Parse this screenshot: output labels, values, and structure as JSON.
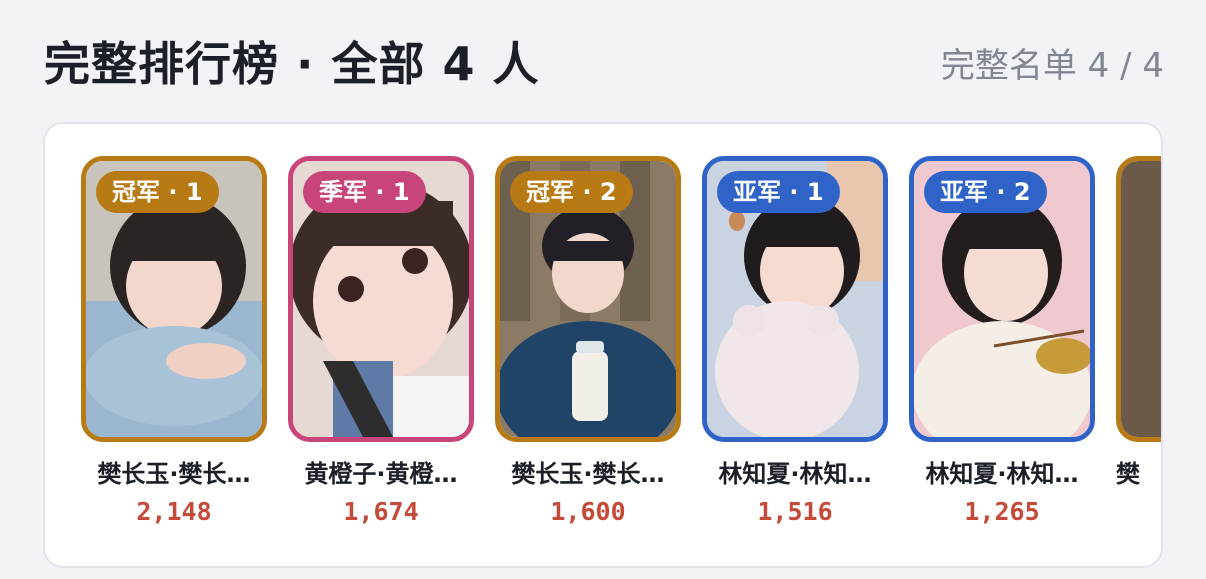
{
  "header": {
    "title": "完整排行榜 · 全部 4 人",
    "count": "完整名单 4 / 4"
  },
  "colors": {
    "champion": "#b87a14",
    "season": "#c8457a",
    "runner_up": "#2f63c8"
  },
  "cards": [
    {
      "badge": "冠军 · 1",
      "tier": "champion",
      "name": "樊长玉·樊长…",
      "votes": "2,148"
    },
    {
      "badge": "季军 · 1",
      "tier": "season",
      "name": "黄橙子·黄橙…",
      "votes": "1,674"
    },
    {
      "badge": "冠军 · 2",
      "tier": "champion",
      "name": "樊长玉·樊长…",
      "votes": "1,600"
    },
    {
      "badge": "亚军 · 1",
      "tier": "runner_up",
      "name": "林知夏·林知…",
      "votes": "1,516"
    },
    {
      "badge": "亚军 · 2",
      "tier": "runner_up",
      "name": "林知夏·林知…",
      "votes": "1,265"
    },
    {
      "badge": "",
      "tier": "champion",
      "name": "樊",
      "votes": ""
    }
  ]
}
